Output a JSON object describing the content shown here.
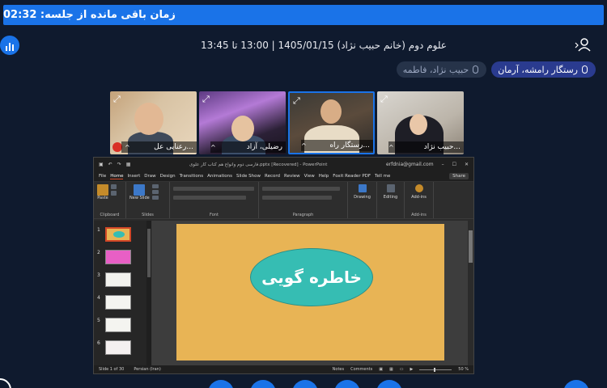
{
  "timer": {
    "label": "زمان باقی مانده از جلسه: 02:32"
  },
  "header": {
    "meeting_title": "علوم دوم (خانم حبیب نژاد) 1405/01/15 | 13:00 تا 13:45"
  },
  "speakers": [
    {
      "name": "رستگار رامشه، آرمان",
      "state": "active"
    },
    {
      "name": "حبیب نژاد، فاطمه",
      "state": "muted"
    }
  ],
  "tiles": [
    {
      "name": "رعنایی عل...",
      "muted": true
    },
    {
      "name": "رضیلی، آزاد",
      "muted": false
    },
    {
      "name": "رستگار راه...",
      "muted": false,
      "active": true
    },
    {
      "name": "حبیب نژاد...",
      "muted": false
    }
  ],
  "ppt": {
    "window_title": "فارسی دوم وانواع هم کتاب کار علوی.pptx [Recovered] - PowerPoint",
    "account": "erfdnia@gmail.com",
    "menu": [
      "File",
      "Home",
      "Insert",
      "Draw",
      "Design",
      "Transitions",
      "Animations",
      "Slide Show",
      "Record",
      "Review",
      "View",
      "Help",
      "Foxit Reader PDF",
      "Tell me"
    ],
    "share_label": "Share",
    "ribbon": {
      "clipboard": "Clipboard",
      "paste": "Paste",
      "slides": "Slides",
      "new_slide": "New Slide",
      "font": "Font",
      "paragraph": "Paragraph",
      "drawing": "Drawing",
      "editing": "Editing",
      "addins": "Add-ins",
      "addins_btn": "Add-ins"
    },
    "thumbnail_numbers": [
      "1",
      "2",
      "3",
      "4",
      "5",
      "6"
    ],
    "slide_text": "خاطره گویی",
    "status": {
      "slide_count": "Slide 1 of 30",
      "language": "Persian (Iran)",
      "notes": "Notes",
      "comments": "Comments",
      "zoom": "50 %"
    }
  },
  "colors": {
    "accent": "#1a73e8",
    "slide_bg": "#e8b455",
    "ellipse": "#36bdb3",
    "ppt_accent": "#d24726"
  }
}
